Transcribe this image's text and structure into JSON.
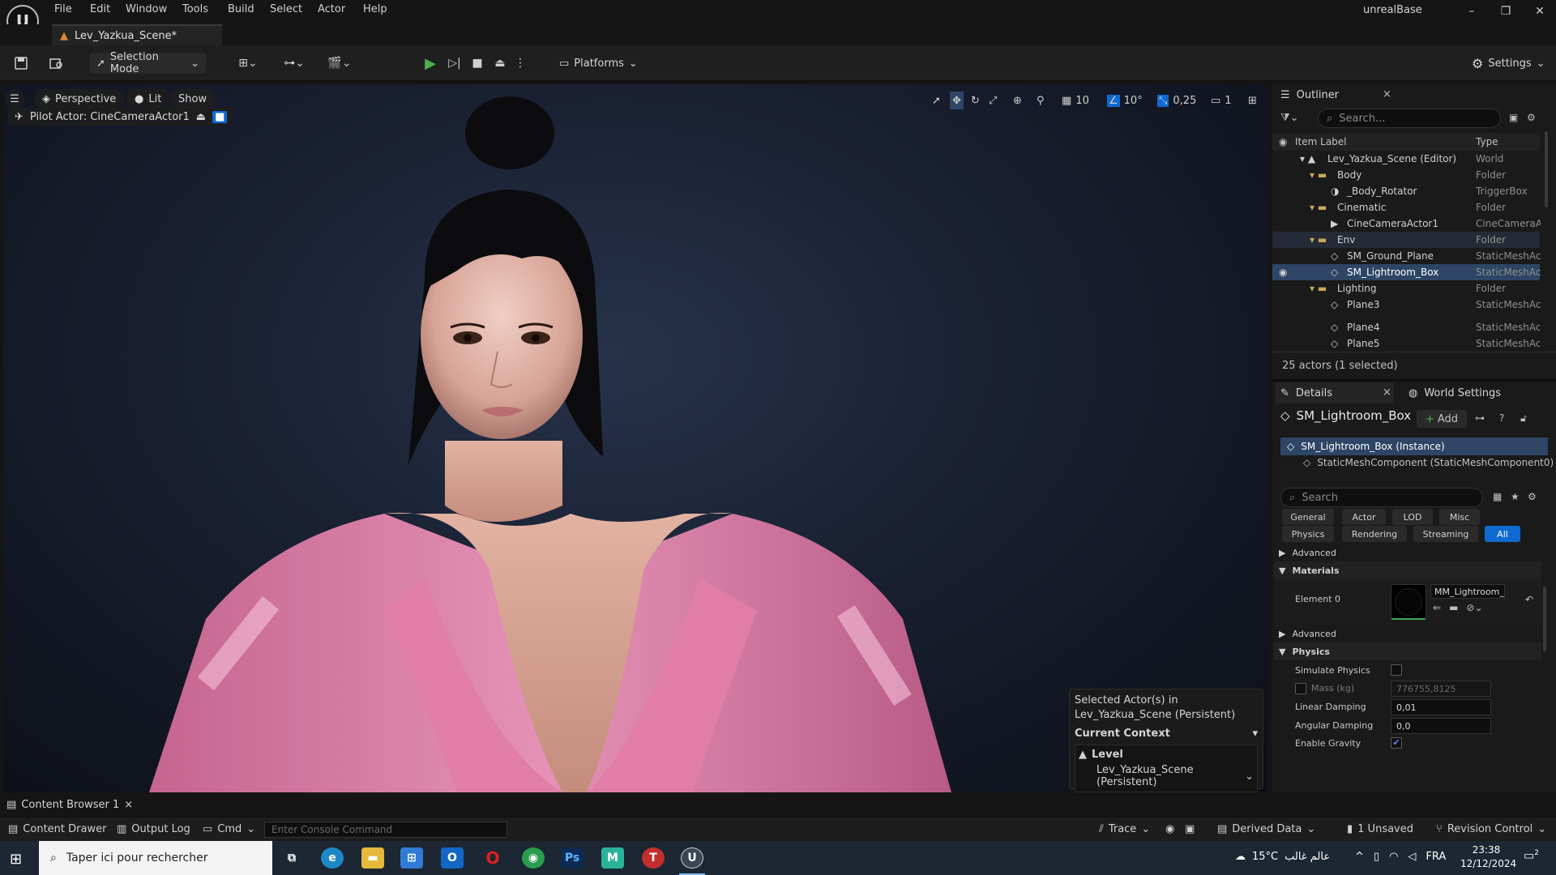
{
  "app": {
    "project_name": "unrealBase",
    "logo": "unreal-logo"
  },
  "menu": [
    "File",
    "Edit",
    "Window",
    "Tools",
    "Build",
    "Select",
    "Actor",
    "Help"
  ],
  "window_controls": {
    "minimize": "–",
    "restore": "❐",
    "close": "✕"
  },
  "tab": {
    "title": "Lev_Yazkua_Scene*"
  },
  "toolbar": {
    "selection_mode": "Selection Mode",
    "platforms": "Platforms",
    "settings": "Settings"
  },
  "viewport": {
    "menu_icon": "☰",
    "perspective": "Perspective",
    "lit": "Lit",
    "show": "Show",
    "pilot_actor": "Pilot Actor: CineCameraActor1",
    "grid_size": "10",
    "rotation_snap": "10°",
    "scale_snap": "0,25",
    "camera_speed": "1",
    "context": {
      "line1": "Selected Actor(s) in",
      "line2": "Lev_Yazkua_Scene (Persistent)",
      "header": "Current Context",
      "level_label": "Level",
      "level_value": "Lev_Yazkua_Scene (Persistent)"
    }
  },
  "outliner": {
    "title": "Outliner",
    "close": "×",
    "search_placeholder": "Search...",
    "col_label": "Item Label",
    "col_type": "Type",
    "rows": [
      {
        "label": "Lev_Yazkua_Scene (Editor)",
        "type": "World"
      },
      {
        "label": "Body",
        "type": "Folder"
      },
      {
        "label": "_Body_Rotator",
        "type": "TriggerBox"
      },
      {
        "label": "Cinematic",
        "type": "Folder"
      },
      {
        "label": "CineCameraActor1",
        "type": "CineCameraA"
      },
      {
        "label": "Env",
        "type": "Folder"
      },
      {
        "label": "SM_Ground_Plane",
        "type": "StaticMeshAc"
      },
      {
        "label": "SM_Lightroom_Box",
        "type": "StaticMeshAc"
      },
      {
        "label": "Lighting",
        "type": "Folder"
      },
      {
        "label": "Plane3",
        "type": "StaticMeshAc"
      },
      {
        "label": "Plane4",
        "type": "StaticMeshAc"
      },
      {
        "label": "Plane5",
        "type": "StaticMeshAc"
      }
    ],
    "footer": "25 actors (1 selected)"
  },
  "details": {
    "title": "Details",
    "close": "×",
    "world_settings": "World Settings",
    "actor_name": "SM_Lightroom_Box",
    "add": "Add",
    "instance": "SM_Lightroom_Box (Instance)",
    "component": "StaticMeshComponent (StaticMeshComponent0)",
    "search_placeholder": "Search",
    "categories": [
      "General",
      "Actor",
      "LOD",
      "Misc",
      "Physics",
      "Rendering",
      "Streaming",
      "All"
    ],
    "sections": {
      "advanced": "Advanced",
      "materials": "Materials",
      "element0": "Element 0",
      "material_name": "MM_Lightroom_Bo",
      "advanced2": "Advanced",
      "physics": "Physics"
    },
    "physics": {
      "simulate_physics": "Simulate Physics",
      "mass_label": "Mass (kg)",
      "mass_value": "776755,8125",
      "linear_damping_label": "Linear Damping",
      "linear_damping": "0,01",
      "angular_damping_label": "Angular Damping",
      "angular_damping": "0,0",
      "enable_gravity": "Enable Gravity"
    }
  },
  "bottom": {
    "content_browser_tab": "Content Browser 1",
    "content_drawer": "Content Drawer",
    "output_log": "Output Log",
    "cmd": "Cmd",
    "console_placeholder": "Enter Console Command",
    "trace": "Trace",
    "derived_data": "Derived Data",
    "unsaved": "1 Unsaved",
    "revision_control": "Revision Control"
  },
  "taskbar": {
    "search_placeholder": "Taper ici pour rechercher",
    "temperature": "15°C",
    "weather": "عالم غالب",
    "language": "FRA",
    "time": "23:38",
    "date": "12/12/2024",
    "notifications": "2"
  },
  "colors": {
    "accent": "#2e4565",
    "play": "#4caf50",
    "pink_hoodie": "#d77aa6",
    "all_tab": "#0e6ad1"
  }
}
